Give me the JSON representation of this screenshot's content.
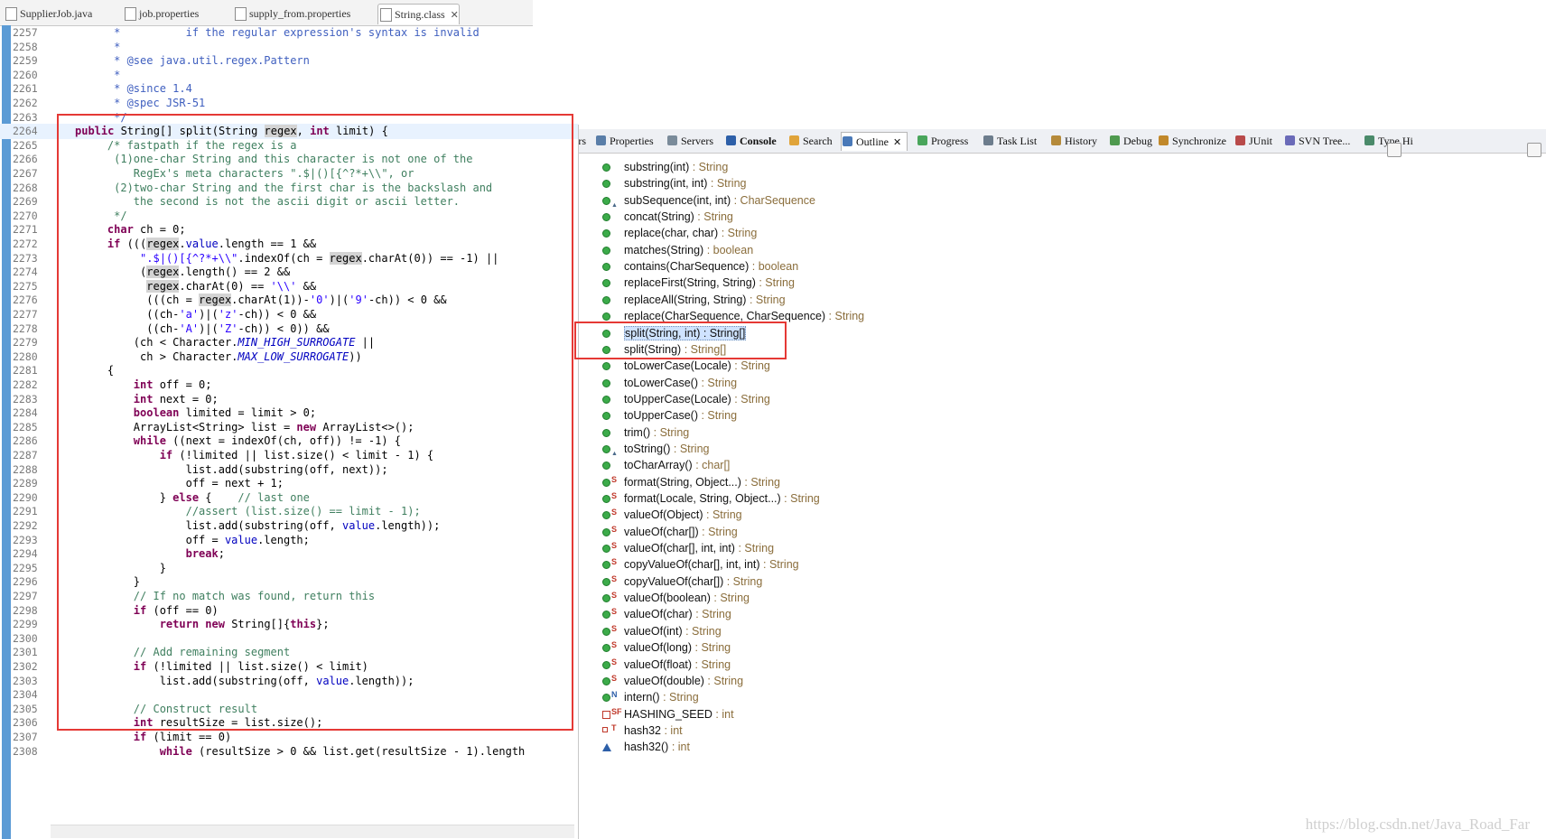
{
  "editor_tabs": [
    {
      "label": "SupplierJob.java",
      "active": false
    },
    {
      "label": "job.properties",
      "active": false
    },
    {
      "label": "supply_from.properties",
      "active": false
    },
    {
      "label": "String.class",
      "active": true
    }
  ],
  "close_glyph": "✕",
  "code_lines": [
    {
      "n": "2257",
      "tokens": [
        {
          "t": "     *          if the regular expression's syntax is invalid",
          "c": "jd"
        }
      ]
    },
    {
      "n": "2258",
      "tokens": [
        {
          "t": "     *",
          "c": "jd"
        }
      ]
    },
    {
      "n": "2259",
      "tokens": [
        {
          "t": "     * @see java.util.regex.Pattern",
          "c": "jd"
        }
      ]
    },
    {
      "n": "2260",
      "tokens": [
        {
          "t": "     *",
          "c": "jd"
        }
      ]
    },
    {
      "n": "2261",
      "tokens": [
        {
          "t": "     * @since 1.4",
          "c": "jd"
        }
      ]
    },
    {
      "n": "2262",
      "tokens": [
        {
          "t": "     * @spec JSR-51",
          "c": "jd"
        }
      ]
    },
    {
      "n": "2263",
      "tokens": [
        {
          "t": "     */",
          "c": "jd"
        }
      ]
    },
    {
      "n": "2264",
      "current": true,
      "tokens": [
        {
          "t": "public",
          "c": "kw"
        },
        {
          "t": " String[] split(String "
        },
        {
          "t": "regex",
          "c": "hl"
        },
        {
          "t": ", "
        },
        {
          "t": "int",
          "c": "kw"
        },
        {
          "t": " limit) {"
        }
      ]
    },
    {
      "n": "2265",
      "tokens": [
        {
          "t": "    /* fastpath if the regex is a",
          "c": "cm"
        }
      ]
    },
    {
      "n": "2266",
      "tokens": [
        {
          "t": "     (1)one-char String and this character is not one of the",
          "c": "cm"
        }
      ]
    },
    {
      "n": "2267",
      "tokens": [
        {
          "t": "        RegEx's meta characters \".$|()[{^?*+\\\\\", or",
          "c": "cm"
        }
      ]
    },
    {
      "n": "2268",
      "tokens": [
        {
          "t": "     (2)two-char String and the first char is the backslash and",
          "c": "cm"
        }
      ]
    },
    {
      "n": "2269",
      "tokens": [
        {
          "t": "        the second is not the ascii digit or ascii letter.",
          "c": "cm"
        }
      ]
    },
    {
      "n": "2270",
      "tokens": [
        {
          "t": "     */",
          "c": "cm"
        }
      ]
    },
    {
      "n": "2271",
      "tokens": [
        {
          "t": "    "
        },
        {
          "t": "char",
          "c": "kw"
        },
        {
          "t": " ch = 0;"
        }
      ]
    },
    {
      "n": "2272",
      "tokens": [
        {
          "t": "    "
        },
        {
          "t": "if",
          "c": "kw"
        },
        {
          "t": " ((("
        },
        {
          "t": "regex",
          "c": "hl"
        },
        {
          "t": "."
        },
        {
          "t": "value",
          "c": "fd"
        },
        {
          "t": ".length == 1 &&"
        }
      ]
    },
    {
      "n": "2273",
      "tokens": [
        {
          "t": "         "
        },
        {
          "t": "\".$|()[{^?*+\\\\\"",
          "c": "st"
        },
        {
          "t": ".indexOf(ch = "
        },
        {
          "t": "regex",
          "c": "hl"
        },
        {
          "t": ".charAt(0)) == -1) ||"
        }
      ]
    },
    {
      "n": "2274",
      "tokens": [
        {
          "t": "         ("
        },
        {
          "t": "regex",
          "c": "hl"
        },
        {
          "t": ".length() == 2 &&"
        }
      ]
    },
    {
      "n": "2275",
      "tokens": [
        {
          "t": "          "
        },
        {
          "t": "regex",
          "c": "hl"
        },
        {
          "t": ".charAt(0) == "
        },
        {
          "t": "'\\\\'",
          "c": "st"
        },
        {
          "t": " &&"
        }
      ]
    },
    {
      "n": "2276",
      "tokens": [
        {
          "t": "          (((ch = "
        },
        {
          "t": "regex",
          "c": "hl"
        },
        {
          "t": ".charAt(1))-"
        },
        {
          "t": "'0'",
          "c": "st"
        },
        {
          "t": ")|("
        },
        {
          "t": "'9'",
          "c": "st"
        },
        {
          "t": "-ch)) < 0 &&"
        }
      ]
    },
    {
      "n": "2277",
      "tokens": [
        {
          "t": "          ((ch-"
        },
        {
          "t": "'a'",
          "c": "st"
        },
        {
          "t": ")|("
        },
        {
          "t": "'z'",
          "c": "st"
        },
        {
          "t": "-ch)) < 0 &&"
        }
      ]
    },
    {
      "n": "2278",
      "tokens": [
        {
          "t": "          ((ch-"
        },
        {
          "t": "'A'",
          "c": "st"
        },
        {
          "t": ")|("
        },
        {
          "t": "'Z'",
          "c": "st"
        },
        {
          "t": "-ch)) < 0)) &&"
        }
      ]
    },
    {
      "n": "2279",
      "tokens": [
        {
          "t": "        (ch < Character."
        },
        {
          "t": "MIN_HIGH_SURROGATE",
          "c": "sf"
        },
        {
          "t": " ||"
        }
      ]
    },
    {
      "n": "2280",
      "tokens": [
        {
          "t": "         ch > Character."
        },
        {
          "t": "MAX_LOW_SURROGATE",
          "c": "sf"
        },
        {
          "t": "))"
        }
      ]
    },
    {
      "n": "2281",
      "tokens": [
        {
          "t": "    {"
        }
      ]
    },
    {
      "n": "2282",
      "tokens": [
        {
          "t": "        "
        },
        {
          "t": "int",
          "c": "kw"
        },
        {
          "t": " off = 0;"
        }
      ]
    },
    {
      "n": "2283",
      "tokens": [
        {
          "t": "        "
        },
        {
          "t": "int",
          "c": "kw"
        },
        {
          "t": " next = 0;"
        }
      ]
    },
    {
      "n": "2284",
      "tokens": [
        {
          "t": "        "
        },
        {
          "t": "boolean",
          "c": "kw"
        },
        {
          "t": " limited = limit > 0;"
        }
      ]
    },
    {
      "n": "2285",
      "tokens": [
        {
          "t": "        ArrayList<String> list = "
        },
        {
          "t": "new",
          "c": "kw"
        },
        {
          "t": " ArrayList<>();"
        }
      ]
    },
    {
      "n": "2286",
      "tokens": [
        {
          "t": "        "
        },
        {
          "t": "while",
          "c": "kw"
        },
        {
          "t": " ((next = indexOf(ch, off)) != -1) {"
        }
      ]
    },
    {
      "n": "2287",
      "tokens": [
        {
          "t": "            "
        },
        {
          "t": "if",
          "c": "kw"
        },
        {
          "t": " (!limited || list.size() < limit - 1) {"
        }
      ]
    },
    {
      "n": "2288",
      "tokens": [
        {
          "t": "                list.add(substring(off, next));"
        }
      ]
    },
    {
      "n": "2289",
      "tokens": [
        {
          "t": "                off = next + 1;"
        }
      ]
    },
    {
      "n": "2290",
      "tokens": [
        {
          "t": "            } "
        },
        {
          "t": "else",
          "c": "kw"
        },
        {
          "t": " {    "
        },
        {
          "t": "// last one",
          "c": "cm"
        }
      ]
    },
    {
      "n": "2291",
      "tokens": [
        {
          "t": "                //assert (list.size() == limit - 1);",
          "c": "cm"
        }
      ]
    },
    {
      "n": "2292",
      "tokens": [
        {
          "t": "                list.add(substring(off, "
        },
        {
          "t": "value",
          "c": "fd"
        },
        {
          "t": ".length));"
        }
      ]
    },
    {
      "n": "2293",
      "tokens": [
        {
          "t": "                off = "
        },
        {
          "t": "value",
          "c": "fd"
        },
        {
          "t": ".length;"
        }
      ]
    },
    {
      "n": "2294",
      "tokens": [
        {
          "t": "                "
        },
        {
          "t": "break",
          "c": "kw"
        },
        {
          "t": ";"
        }
      ]
    },
    {
      "n": "2295",
      "tokens": [
        {
          "t": "            }"
        }
      ]
    },
    {
      "n": "2296",
      "tokens": [
        {
          "t": "        }"
        }
      ]
    },
    {
      "n": "2297",
      "tokens": [
        {
          "t": "        // If no match was found, return this",
          "c": "cm"
        }
      ]
    },
    {
      "n": "2298",
      "tokens": [
        {
          "t": "        "
        },
        {
          "t": "if",
          "c": "kw"
        },
        {
          "t": " (off == 0)"
        }
      ]
    },
    {
      "n": "2299",
      "tokens": [
        {
          "t": "            "
        },
        {
          "t": "return",
          "c": "kw"
        },
        {
          "t": " "
        },
        {
          "t": "new",
          "c": "kw"
        },
        {
          "t": " String[]{"
        },
        {
          "t": "this",
          "c": "kw"
        },
        {
          "t": "};"
        }
      ]
    },
    {
      "n": "2300",
      "tokens": [
        {
          "t": ""
        }
      ]
    },
    {
      "n": "2301",
      "tokens": [
        {
          "t": "        // Add remaining segment",
          "c": "cm"
        }
      ]
    },
    {
      "n": "2302",
      "tokens": [
        {
          "t": "        "
        },
        {
          "t": "if",
          "c": "kw"
        },
        {
          "t": " (!limited || list.size() < limit)"
        }
      ]
    },
    {
      "n": "2303",
      "tokens": [
        {
          "t": "            list.add(substring(off, "
        },
        {
          "t": "value",
          "c": "fd"
        },
        {
          "t": ".length));"
        }
      ]
    },
    {
      "n": "2304",
      "tokens": [
        {
          "t": ""
        }
      ]
    },
    {
      "n": "2305",
      "tokens": [
        {
          "t": "        // Construct result",
          "c": "cm"
        }
      ]
    },
    {
      "n": "2306",
      "tokens": [
        {
          "t": "        "
        },
        {
          "t": "int",
          "c": "kw"
        },
        {
          "t": " resultSize = list.size();"
        }
      ]
    },
    {
      "n": "2307",
      "tokens": [
        {
          "t": "        "
        },
        {
          "t": "if",
          "c": "kw"
        },
        {
          "t": " (limit == 0)"
        }
      ]
    },
    {
      "n": "2308",
      "tokens": [
        {
          "t": "            "
        },
        {
          "t": "while",
          "c": "kw"
        },
        {
          "t": " (resultSize > 0 && list.get(resultSize - 1).length"
        }
      ]
    }
  ],
  "view_tabs": [
    {
      "label": "Markers",
      "icon": "markers-icon",
      "color": "#c78b2c",
      "active": false
    },
    {
      "label": "Properties",
      "icon": "properties-icon",
      "color": "#5a7ea8",
      "active": false
    },
    {
      "label": "Servers",
      "icon": "servers-icon",
      "color": "#7a8b9a",
      "active": false
    },
    {
      "label": "Console",
      "icon": "console-icon",
      "color": "#2d5fa8",
      "active": false,
      "bold": true
    },
    {
      "label": "Search",
      "icon": "search-icon",
      "color": "#e0a43a",
      "active": false
    },
    {
      "label": "Outline",
      "icon": "outline-icon",
      "color": "#4a79b8",
      "active": true
    },
    {
      "label": "Progress",
      "icon": "progress-icon",
      "color": "#49a55b",
      "active": false
    },
    {
      "label": "Task List",
      "icon": "task-list-icon",
      "color": "#6c7c8c",
      "active": false
    },
    {
      "label": "History",
      "icon": "history-icon",
      "color": "#b58a3a",
      "active": false
    },
    {
      "label": "Debug",
      "icon": "debug-icon",
      "color": "#4f9a4f",
      "active": false
    },
    {
      "label": "Synchronize",
      "icon": "synchronize-icon",
      "color": "#c1882a",
      "active": false
    },
    {
      "label": "JUnit",
      "icon": "junit-icon",
      "color": "#b84a4a",
      "active": false
    },
    {
      "label": "SVN Tree...",
      "icon": "svn-tree-icon",
      "color": "#6a6ab8",
      "active": false
    },
    {
      "label": "Type Hi",
      "icon": "type-hierarchy-icon",
      "color": "#4a8a6a",
      "active": false
    }
  ],
  "outline_items": [
    {
      "name": "substring(int)",
      "type": " : String",
      "mod": ""
    },
    {
      "name": "substring(int, int)",
      "type": " : String",
      "mod": ""
    },
    {
      "name": "subSequence(int, int)",
      "type": " : CharSequence",
      "mod": "▲"
    },
    {
      "name": "concat(String)",
      "type": " : String",
      "mod": ""
    },
    {
      "name": "replace(char, char)",
      "type": " : String",
      "mod": ""
    },
    {
      "name": "matches(String)",
      "type": " : boolean",
      "mod": ""
    },
    {
      "name": "contains(CharSequence)",
      "type": " : boolean",
      "mod": ""
    },
    {
      "name": "replaceFirst(String, String)",
      "type": " : String",
      "mod": ""
    },
    {
      "name": "replaceAll(String, String)",
      "type": " : String",
      "mod": ""
    },
    {
      "name": "replace(CharSequence, CharSequence)",
      "type": " : String",
      "mod": ""
    },
    {
      "name": "split(String, int)",
      "type": " : String[]",
      "mod": "",
      "selected": true
    },
    {
      "name": "split(String)",
      "type": " : String[]",
      "mod": ""
    },
    {
      "name": "toLowerCase(Locale)",
      "type": " : String",
      "mod": ""
    },
    {
      "name": "toLowerCase()",
      "type": " : String",
      "mod": ""
    },
    {
      "name": "toUpperCase(Locale)",
      "type": " : String",
      "mod": ""
    },
    {
      "name": "toUpperCase()",
      "type": " : String",
      "mod": ""
    },
    {
      "name": "trim()",
      "type": " : String",
      "mod": ""
    },
    {
      "name": "toString()",
      "type": " : String",
      "mod": "▲"
    },
    {
      "name": "toCharArray()",
      "type": " : char[]",
      "mod": ""
    },
    {
      "name": "format(String, Object...)",
      "type": " : String",
      "mod": "S"
    },
    {
      "name": "format(Locale, String, Object...)",
      "type": " : String",
      "mod": "S"
    },
    {
      "name": "valueOf(Object)",
      "type": " : String",
      "mod": "S"
    },
    {
      "name": "valueOf(char[])",
      "type": " : String",
      "mod": "S"
    },
    {
      "name": "valueOf(char[], int, int)",
      "type": " : String",
      "mod": "S"
    },
    {
      "name": "copyValueOf(char[], int, int)",
      "type": " : String",
      "mod": "S"
    },
    {
      "name": "copyValueOf(char[])",
      "type": " : String",
      "mod": "S"
    },
    {
      "name": "valueOf(boolean)",
      "type": " : String",
      "mod": "S"
    },
    {
      "name": "valueOf(char)",
      "type": " : String",
      "mod": "S"
    },
    {
      "name": "valueOf(int)",
      "type": " : String",
      "mod": "S"
    },
    {
      "name": "valueOf(long)",
      "type": " : String",
      "mod": "S"
    },
    {
      "name": "valueOf(float)",
      "type": " : String",
      "mod": "S"
    },
    {
      "name": "valueOf(double)",
      "type": " : String",
      "mod": "S"
    },
    {
      "name": "intern()",
      "type": " : String",
      "mod": "N"
    },
    {
      "name": "HASHING_SEED",
      "type": " : int",
      "mod": "SF",
      "kind": "field"
    },
    {
      "name": "hash32",
      "type": " : int",
      "mod": "T",
      "kind": "field-private"
    },
    {
      "name": "hash32()",
      "type": " : int",
      "mod": "",
      "kind": "method-default"
    }
  ],
  "watermark": "https://blog.csdn.net/Java_Road_Far",
  "colors": {
    "highlight_box": "#e53935",
    "method_public": "#3cab4a",
    "ruler": "#5b9bd5"
  }
}
